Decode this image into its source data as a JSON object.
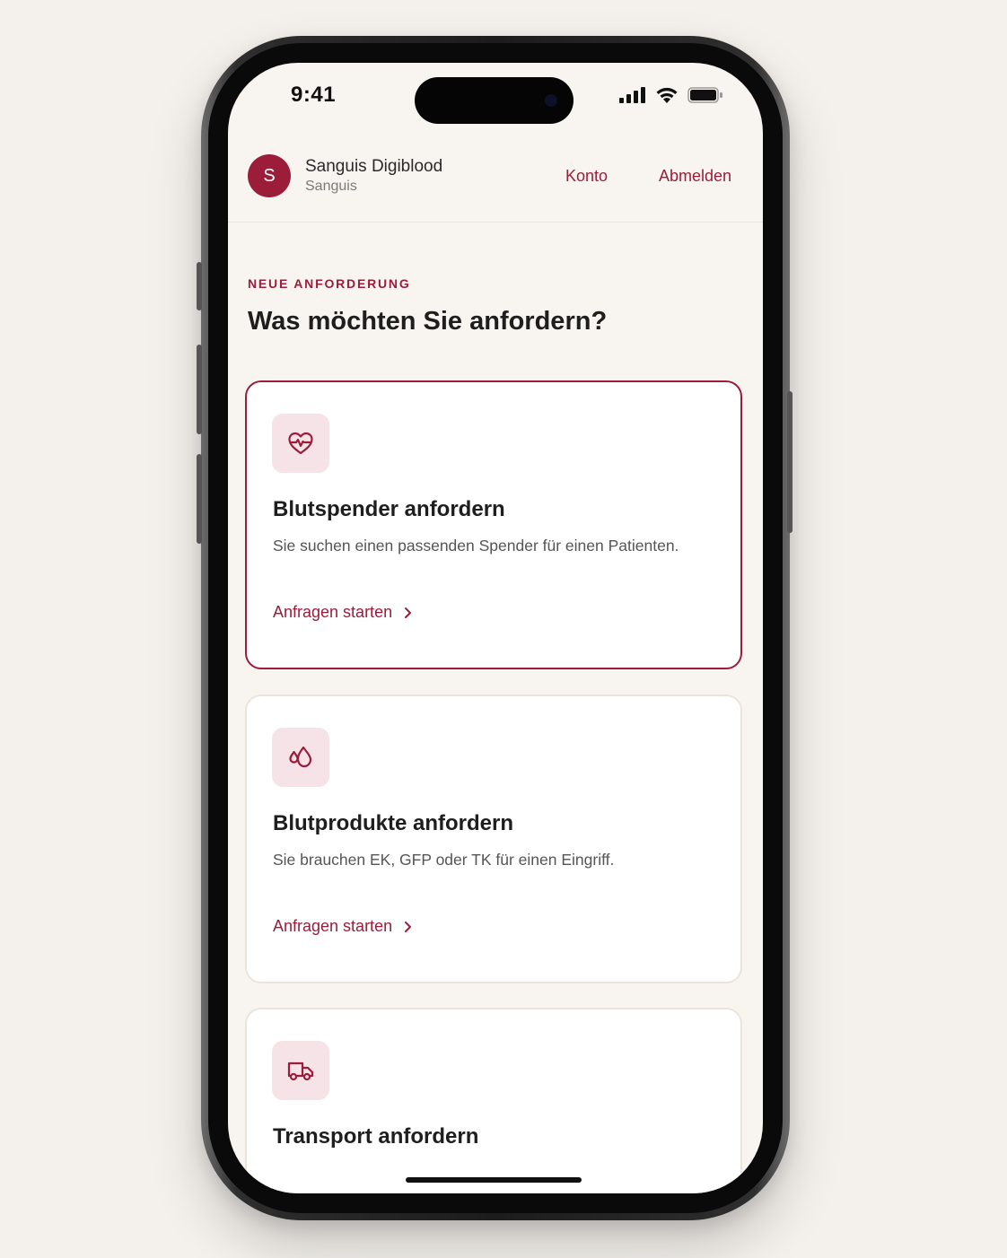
{
  "status_bar": {
    "time": "9:41",
    "icons": [
      "signal-icon",
      "wifi-icon",
      "battery-icon"
    ]
  },
  "header": {
    "avatar_letter": "S",
    "org_name": "Sanguis Digiblood",
    "org_sub": "Sanguis",
    "nav": {
      "konto": "Konto",
      "abmelden": "Abmelden"
    }
  },
  "main": {
    "eyebrow": "NEUE ANFORDERUNG",
    "title": "Was möchten Sie anfordern?",
    "cards": [
      {
        "icon": "heart-pulse-icon",
        "title": "Blutspender anfordern",
        "description": "Sie suchen einen passenden Spender für einen Patienten.",
        "link": "Anfragen starten",
        "selected": true
      },
      {
        "icon": "blood-drops-icon",
        "title": "Blutprodukte anfordern",
        "description": "Sie brauchen EK, GFP oder TK für einen Eingriff.",
        "link": "Anfragen starten",
        "selected": false
      },
      {
        "icon": "truck-icon",
        "title": "Transport anfordern",
        "selected": false
      }
    ]
  },
  "colors": {
    "accent": "#9b1d3a",
    "background": "#f8f5f0",
    "icon_bg": "#f6e3e8"
  }
}
